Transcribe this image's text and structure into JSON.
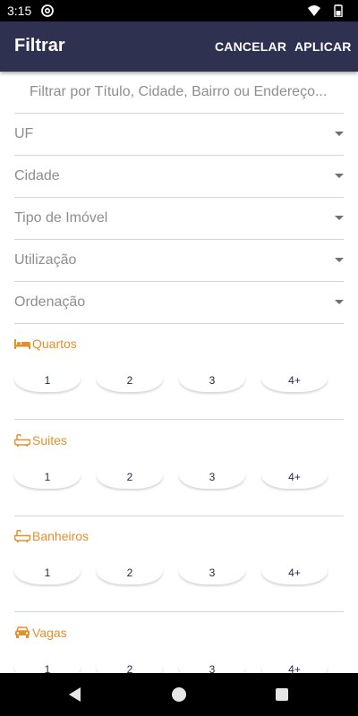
{
  "status_bar": {
    "time": "3:15",
    "icons": [
      "at-sign-icon",
      "wifi-icon",
      "battery-icon"
    ]
  },
  "header": {
    "title": "Filtrar",
    "cancel_label": "CANCELAR",
    "apply_label": "APLICAR",
    "background_color": "#2e3150"
  },
  "search": {
    "placeholder": "Filtrar por Título, Cidade, Bairro ou Endereço...",
    "value": ""
  },
  "dropdowns": [
    {
      "label": "UF"
    },
    {
      "label": "Cidade"
    },
    {
      "label": "Tipo de Imóvel"
    },
    {
      "label": "Utilização"
    },
    {
      "label": "Ordenação"
    }
  ],
  "sections": [
    {
      "label": "Quartos",
      "icon": "bed-icon",
      "options": [
        "1",
        "2",
        "3",
        "4+"
      ]
    },
    {
      "label": "Suites",
      "icon": "bathtub-icon",
      "options": [
        "1",
        "2",
        "3",
        "4+"
      ]
    },
    {
      "label": "Banheiros",
      "icon": "bathtub-icon",
      "options": [
        "1",
        "2",
        "3",
        "4+"
      ]
    },
    {
      "label": "Vagas",
      "icon": "car-icon",
      "options": [
        "1",
        "2",
        "3",
        "4+"
      ]
    }
  ],
  "accent_color": "#e3902b",
  "nav_bar": {
    "buttons": [
      "back-icon",
      "home-icon",
      "recent-apps-icon"
    ]
  }
}
